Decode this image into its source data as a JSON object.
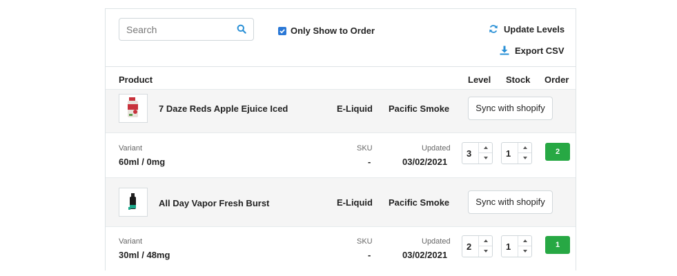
{
  "toolbar": {
    "search_placeholder": "Search",
    "search_icon": "search-icon",
    "only_show_to_order_label": "Only Show to Order",
    "only_show_to_order_checked": true,
    "update_levels_label": "Update Levels",
    "update_levels_icon": "refresh-icon",
    "export_csv_label": "Export CSV",
    "export_csv_icon": "download-icon"
  },
  "table": {
    "headers": {
      "product": "Product",
      "level": "Level",
      "stock": "Stock",
      "order": "Order"
    },
    "rows": [
      {
        "product_name": "7 Daze Reds Apple Ejuice Iced",
        "type": "E-Liquid",
        "vendor": "Pacific Smoke",
        "sync_label": "Sync with shopify",
        "variant_label": "Variant",
        "variant_value": "60ml / 0mg",
        "sku_label": "SKU",
        "sku_value": "-",
        "updated_label": "Updated",
        "updated_value": "03/02/2021",
        "level": "3",
        "stock": "1",
        "order": "2"
      },
      {
        "product_name": "All Day Vapor Fresh Burst",
        "type": "E-Liquid",
        "vendor": "Pacific Smoke",
        "sync_label": "Sync with shopify",
        "variant_label": "Variant",
        "variant_value": "30ml / 48mg",
        "sku_label": "SKU",
        "sku_value": "-",
        "updated_label": "Updated",
        "updated_value": "03/02/2021",
        "level": "2",
        "stock": "1",
        "order": "1"
      }
    ]
  },
  "colors": {
    "accent_blue": "#2a90d6",
    "order_green": "#27a844",
    "product_row_bg": "#f5f5f5"
  }
}
